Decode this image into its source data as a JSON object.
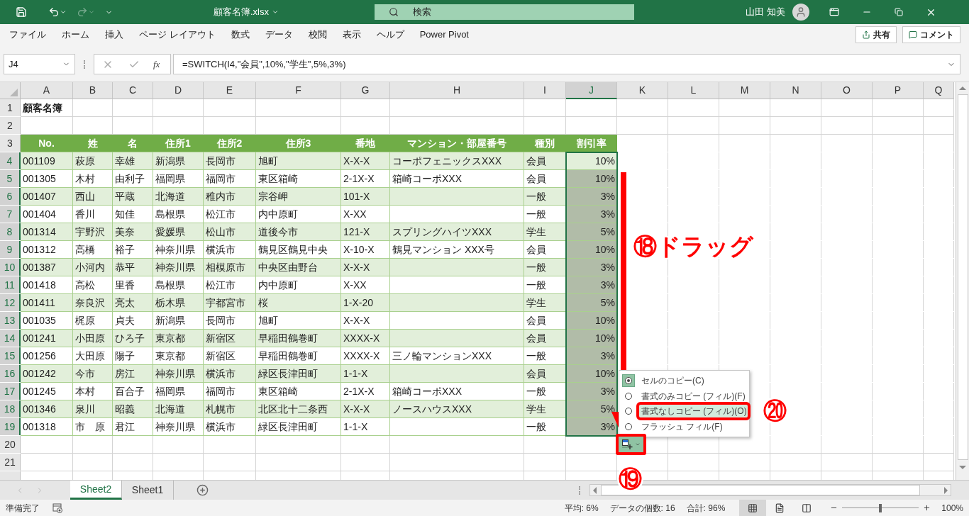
{
  "title_bar": {
    "file_name": "顧客名簿.xlsx",
    "search_placeholder": "検索",
    "user_name": "山田 知美"
  },
  "ribbon_tabs": [
    {
      "label": "ファイル"
    },
    {
      "label": "ホーム"
    },
    {
      "label": "挿入"
    },
    {
      "label": "ページ レイアウト"
    },
    {
      "label": "数式"
    },
    {
      "label": "データ"
    },
    {
      "label": "校閲"
    },
    {
      "label": "表示"
    },
    {
      "label": "ヘルプ"
    },
    {
      "label": "Power Pivot"
    }
  ],
  "ribbon_buttons": [
    {
      "kind": "share",
      "label": "共有"
    },
    {
      "kind": "comment",
      "label": "コメント"
    }
  ],
  "formula_bar": {
    "name_box": "J4",
    "function_label": "fx",
    "formula": "=SWITCH(I4,\"会員\",10%,\"学生\",5%,3%)"
  },
  "column_headers": [
    {
      "label": "A",
      "selected": false
    },
    {
      "label": "B",
      "selected": false
    },
    {
      "label": "C",
      "selected": false
    },
    {
      "label": "D",
      "selected": false
    },
    {
      "label": "E",
      "selected": false
    },
    {
      "label": "F",
      "selected": false
    },
    {
      "label": "G",
      "selected": false
    },
    {
      "label": "H",
      "selected": false
    },
    {
      "label": "I",
      "selected": false
    },
    {
      "label": "J",
      "selected": true
    },
    {
      "label": "K",
      "selected": false
    },
    {
      "label": "L",
      "selected": false
    },
    {
      "label": "M",
      "selected": false
    },
    {
      "label": "N",
      "selected": false
    },
    {
      "label": "O",
      "selected": false
    },
    {
      "label": "P",
      "selected": false
    },
    {
      "label": "Q",
      "selected": false
    }
  ],
  "rows": [
    {
      "number": "1",
      "kind": "title",
      "cells": [
        "顧客名簿"
      ],
      "selected": false
    },
    {
      "number": "2",
      "kind": "empty",
      "selected": false
    },
    {
      "number": "3",
      "kind": "header",
      "cells": [
        "No.",
        "姓",
        "名",
        "住所1",
        "住所2",
        "住所3",
        "番地",
        "マンション・部屋番号",
        "種別",
        "割引率"
      ],
      "selected": false
    },
    {
      "number": "4",
      "kind": "data",
      "cells": [
        "001109",
        "萩原",
        "幸雄",
        "新潟県",
        "長岡市",
        "旭町",
        "X-X-X",
        "コーポフェニックスXXX",
        "会員",
        "10%"
      ],
      "selected": true,
      "active": true
    },
    {
      "number": "5",
      "kind": "data",
      "cells": [
        "001305",
        "木村",
        "由利子",
        "福岡県",
        "福岡市",
        "東区箱崎",
        "2-1X-X",
        "箱崎コーポXXX",
        "会員",
        "10%"
      ],
      "selected": true,
      "active": false
    },
    {
      "number": "6",
      "kind": "data",
      "cells": [
        "001407",
        "西山",
        "平蔵",
        "北海道",
        "稚内市",
        "宗谷岬",
        "101-X",
        null,
        "一般",
        "3%"
      ],
      "selected": true,
      "active": false
    },
    {
      "number": "7",
      "kind": "data",
      "cells": [
        "001404",
        "香川",
        "知佳",
        "島根県",
        "松江市",
        "内中原町",
        "X-XX",
        null,
        "一般",
        "3%"
      ],
      "selected": true,
      "active": false
    },
    {
      "number": "8",
      "kind": "data",
      "cells": [
        "001314",
        "宇野沢",
        "美奈",
        "愛媛県",
        "松山市",
        "道後今市",
        "121-X",
        "スプリングハイツXXX",
        "学生",
        "5%"
      ],
      "selected": true,
      "active": false
    },
    {
      "number": "9",
      "kind": "data",
      "cells": [
        "001312",
        "高橋",
        "裕子",
        "神奈川県",
        "横浜市",
        "鶴見区鶴見中央",
        "X-10-X",
        "鶴見マンション XXX号",
        "会員",
        "10%"
      ],
      "selected": true,
      "active": false
    },
    {
      "number": "10",
      "kind": "data",
      "cells": [
        "001387",
        "小河内",
        "恭平",
        "神奈川県",
        "相模原市",
        "中央区由野台",
        "X-X-X",
        null,
        "一般",
        "3%"
      ],
      "selected": true,
      "active": false
    },
    {
      "number": "11",
      "kind": "data",
      "cells": [
        "001418",
        "高松",
        "里香",
        "島根県",
        "松江市",
        "内中原町",
        "X-XX",
        null,
        "一般",
        "3%"
      ],
      "selected": true,
      "active": false
    },
    {
      "number": "12",
      "kind": "data",
      "cells": [
        "001411",
        "奈良沢",
        "亮太",
        "栃木県",
        "宇都宮市",
        "桜",
        "1-X-20",
        null,
        "学生",
        "5%"
      ],
      "selected": true,
      "active": false
    },
    {
      "number": "13",
      "kind": "data",
      "cells": [
        "001035",
        "梶原",
        "貞夫",
        "新潟県",
        "長岡市",
        "旭町",
        "X-X-X",
        null,
        "会員",
        "10%"
      ],
      "selected": true,
      "active": false
    },
    {
      "number": "14",
      "kind": "data",
      "cells": [
        "001241",
        "小田原",
        "ひろ子",
        "東京都",
        "新宿区",
        "早稲田鶴巻町",
        "XXXX-X",
        null,
        "会員",
        "10%"
      ],
      "selected": true,
      "active": false
    },
    {
      "number": "15",
      "kind": "data",
      "cells": [
        "001256",
        "大田原",
        "陽子",
        "東京都",
        "新宿区",
        "早稲田鶴巻町",
        "XXXX-X",
        "三ノ輪マンションXXX",
        "一般",
        "3%"
      ],
      "selected": true,
      "active": false
    },
    {
      "number": "16",
      "kind": "data",
      "cells": [
        "001242",
        "今市",
        "房江",
        "神奈川県",
        "横浜市",
        "緑区長津田町",
        "1-1-X",
        null,
        "会員",
        "10%"
      ],
      "selected": true,
      "active": false
    },
    {
      "number": "17",
      "kind": "data",
      "cells": [
        "001245",
        "本村",
        "百合子",
        "福岡県",
        "福岡市",
        "東区箱崎",
        "2-1X-X",
        "箱崎コーポXXX",
        "一般",
        "3%"
      ],
      "selected": true,
      "active": false
    },
    {
      "number": "18",
      "kind": "data",
      "cells": [
        "001346",
        "泉川",
        "昭義",
        "北海道",
        "札幌市",
        "北区北十二条西",
        "X-X-X",
        "ノースハウスXXX",
        "学生",
        "5%"
      ],
      "selected": true,
      "active": false
    },
    {
      "number": "19",
      "kind": "data",
      "cells": [
        "001318",
        "市　原",
        "君江",
        "神奈川県",
        "横浜市",
        "緑区長津田町",
        "1-1-X",
        null,
        "一般",
        "3%"
      ],
      "selected": true,
      "active": false
    },
    {
      "number": "20",
      "kind": "empty",
      "selected": false
    },
    {
      "number": "21",
      "kind": "empty",
      "selected": false
    }
  ],
  "paste_options": {
    "items": [
      {
        "label": "セルのコピー(C)",
        "selected": true,
        "highlighted": false
      },
      {
        "label": "書式のみコピー (フィル)(F)",
        "selected": false,
        "highlighted": false
      },
      {
        "label": "書式なしコピー (フィル)(O)",
        "selected": false,
        "highlighted": true
      },
      {
        "label": "フラッシュ フィル(F)",
        "selected": false,
        "highlighted": false
      }
    ]
  },
  "annotations": [
    {
      "kind": "drag",
      "label": "⑱",
      "text": "ドラッグ"
    },
    {
      "kind": "button",
      "label": "⑲"
    },
    {
      "kind": "menu",
      "label": "⑳"
    }
  ],
  "sheet_tabs": [
    {
      "label": "Sheet2",
      "selected": true
    },
    {
      "label": "Sheet1",
      "selected": false
    }
  ],
  "status_bar": {
    "status": "準備完了",
    "average": "平均: 6%",
    "count": "データの個数: 16",
    "sum": "合計: 96%",
    "views": [
      {
        "kind": "normal",
        "selected": true
      },
      {
        "kind": "page-layout",
        "selected": false
      },
      {
        "kind": "page-break",
        "selected": false
      }
    ],
    "zoom": {
      "level": 0.5,
      "reading": "100%"
    }
  }
}
